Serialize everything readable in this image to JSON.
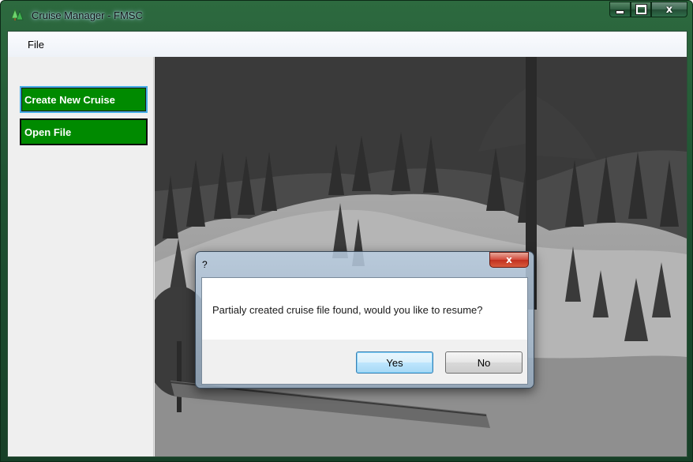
{
  "window": {
    "title": "Cruise Manager - FMSC",
    "close_glyph": "x"
  },
  "menu": {
    "file_label": "File"
  },
  "sidebar": {
    "buttons": [
      {
        "label": "Create New Cruise"
      },
      {
        "label": "Open File"
      }
    ],
    "button_color": "#008a00"
  },
  "background_image": {
    "description_icon": "forest-photo"
  },
  "dialog": {
    "title": "?",
    "close_glyph": "x",
    "message": "Partialy created cruise file found, would you like to resume?",
    "yes_label": "Yes",
    "no_label": "No"
  }
}
